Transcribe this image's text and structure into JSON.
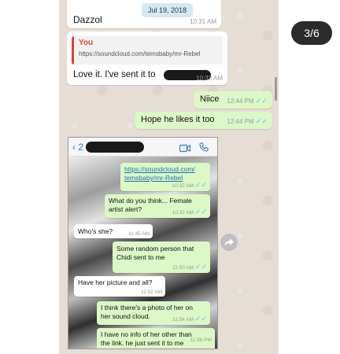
{
  "viewer": {
    "counter": "3/6"
  },
  "outer_chat": {
    "top_message": {
      "text": "Dazzol",
      "time": "10:31 AM"
    },
    "date_pill": "Jul 19, 2018",
    "reply_message": {
      "quote_author": "You",
      "quote_text": "https://soundcloud.com/temsbaby/mr-Rebel",
      "text": "Love it. I've sent it to",
      "time": "10:33 AM"
    },
    "sent": [
      {
        "text": "Niice",
        "time": "12:44 PM",
        "ticks": "✓✓"
      },
      {
        "text": "Hope he likes it too",
        "time": "12:44 PM",
        "ticks": "✓✓"
      }
    ]
  },
  "inner_chat": {
    "header": {
      "back": "‹ 2",
      "video_icon": "video-icon",
      "call_icon": "phone-icon"
    },
    "messages": [
      {
        "dir": "out",
        "link1": "https://soundcloud.com/",
        "link2": "temsbaby/mr-Rebel",
        "time": "10:32 AM",
        "ticks": "✓✓"
      },
      {
        "dir": "out",
        "line1": "What do you think... Female",
        "line2": "artist alert?",
        "time": "10:32 AM",
        "ticks": "✓✓"
      },
      {
        "dir": "in",
        "text": "Who's she?",
        "time": "11:45 AM"
      },
      {
        "dir": "out",
        "line1": "Some random person  that",
        "line2": "Chidi sent to me",
        "time": "11:50 AM",
        "ticks": "✓✓"
      },
      {
        "dir": "in",
        "line1": "Have her picture and all?",
        "time": "11:52 AM"
      },
      {
        "dir": "out",
        "line1": "I think there's a photo of her on",
        "line2": "her sound cloud.",
        "time": "11:54 AM",
        "ticks": "✓✓"
      },
      {
        "dir": "out",
        "line1": "I have no info of her other than",
        "line2": "the link. he just sent it to me",
        "time": "11:56 PM"
      }
    ]
  },
  "colors": {
    "chat_bg": "#e6ddd4",
    "outgoing": "#dcf8c6",
    "incoming": "#ffffff",
    "quote_bar": "#d94438",
    "ticks": "#4fc3f7",
    "link": "#1a73b8"
  }
}
